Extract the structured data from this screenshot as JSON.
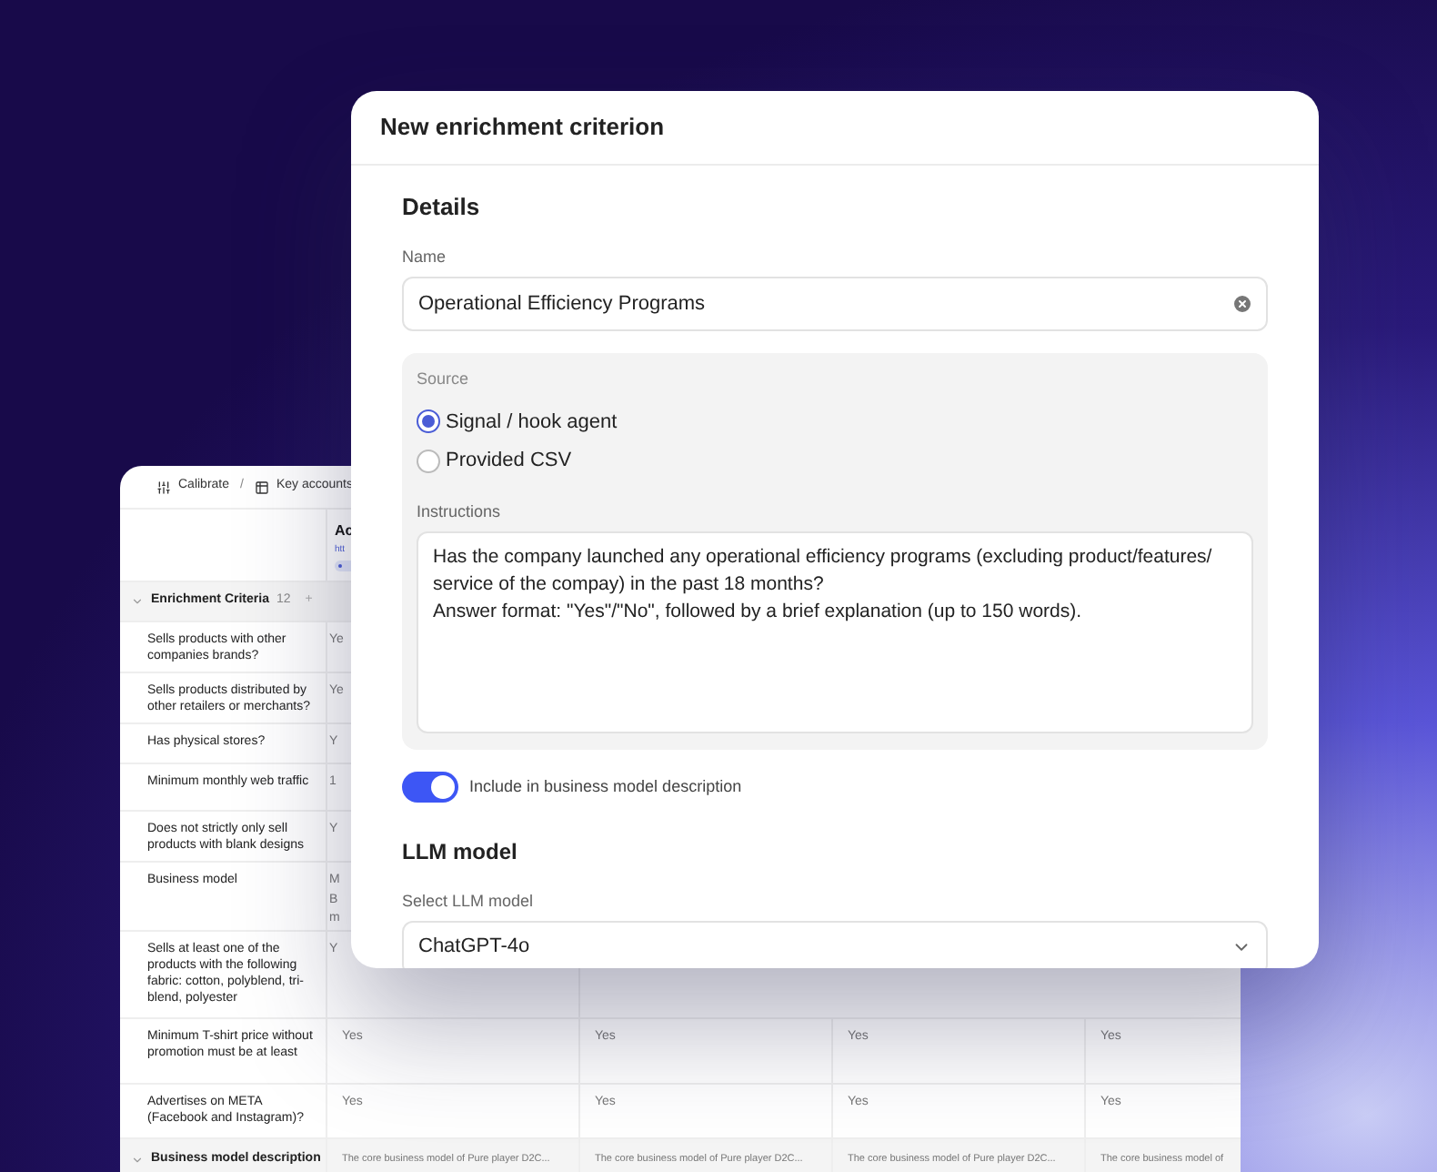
{
  "background_table": {
    "breadcrumb": [
      "Calibrate",
      "/",
      "Key accounts"
    ],
    "column_header": {
      "title": "Ac",
      "link": "htt"
    },
    "group": {
      "label": "Enrichment Criteria",
      "count": "12",
      "add": "+",
      "expanded": true
    },
    "rows": [
      {
        "label": "Sells products with other companies brands?",
        "cells": [
          "Ye"
        ]
      },
      {
        "label": "Sells products distributed by other retailers or merchants?",
        "cells": [
          "Ye"
        ]
      },
      {
        "label": "Has physical stores?",
        "cells": [
          "Y"
        ]
      },
      {
        "label": "Minimum monthly web traffic",
        "cells": [
          "1"
        ]
      },
      {
        "label": "Does not strictly only sell products with blank designs",
        "cells": [
          "Y"
        ]
      },
      {
        "label": "Business model",
        "cells": [
          "M\nB\nm"
        ]
      },
      {
        "label": "Sells at least one of the products with the following fabric: cotton, polyblend, tri-blend, polyester",
        "cells": [
          "Y"
        ]
      },
      {
        "label": "Minimum T-shirt price without promotion must be at least",
        "cells": [
          "Yes",
          "Yes",
          "Yes",
          "Yes"
        ]
      },
      {
        "label": "Advertises on META (Facebook and Instagram)?",
        "cells": [
          "Yes",
          "Yes",
          "Yes",
          "Yes"
        ]
      }
    ],
    "footer_group": {
      "label": "Business model description",
      "expanded": true,
      "cells": [
        "The core business model of Pure player D2C...",
        "The core business model of Pure player D2C...",
        "The core business model of Pure player D2C...",
        "The core business model of"
      ]
    }
  },
  "dialog": {
    "title": "New enrichment criterion",
    "details_heading": "Details",
    "name": {
      "label": "Name",
      "value": "Operational Efficiency Programs"
    },
    "source": {
      "label": "Source",
      "options": [
        {
          "label": "Signal / hook agent",
          "selected": true
        },
        {
          "label": "Provided CSV",
          "selected": false
        }
      ]
    },
    "instructions": {
      "label": "Instructions",
      "value": "Has the company launched any operational efficiency programs (excluding product/features/ service of the compay) in the past 18 months?\nAnswer format: \"Yes\"/\"No\", followed by a brief explanation (up to 150 words)."
    },
    "include_toggle": {
      "label": "Include in business model description",
      "on": true
    },
    "llm_heading": "LLM model",
    "llm_select": {
      "label": "Select LLM model",
      "value": "ChatGPT-4o"
    }
  }
}
